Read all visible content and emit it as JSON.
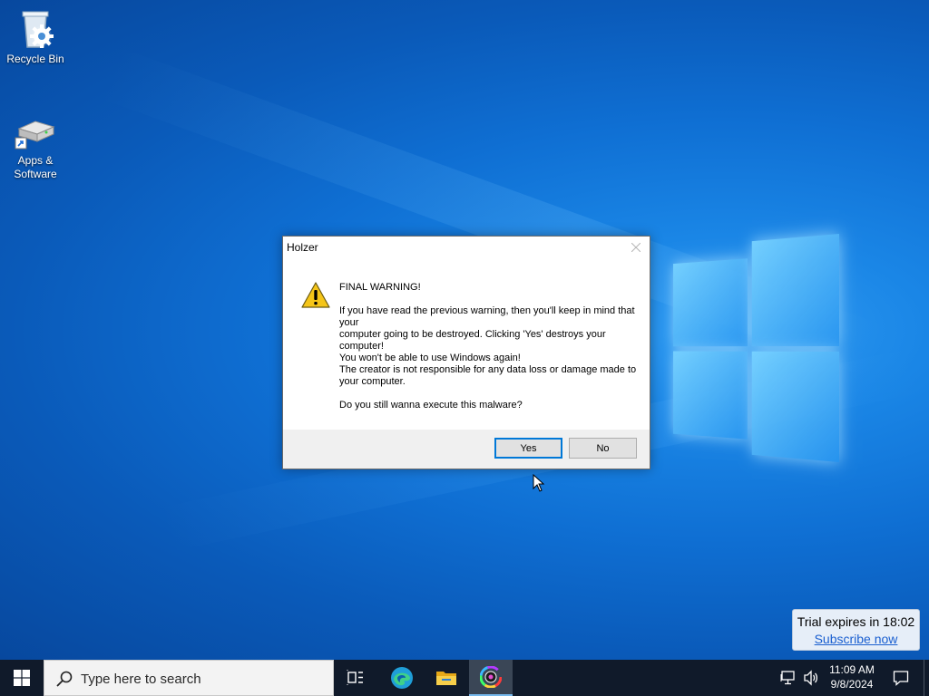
{
  "desktop": {
    "icons": [
      {
        "label": "Recycle Bin",
        "icon": "recycle-bin-icon"
      },
      {
        "label": "Apps & Software",
        "icon": "apps-drive-icon"
      }
    ]
  },
  "dialog": {
    "title": "Holzer",
    "icon": "warning-icon",
    "message": {
      "heading": "FINAL WARNING!",
      "line1": "If you have read the previous warning, then you'll keep in mind that your",
      "line2": "computer going to be destroyed. Clicking 'Yes' destroys your computer!",
      "line3": "You won't be able to use Windows again!",
      "line4": "The creator is not responsible for any data loss or damage made to your computer.",
      "question": "Do you still wanna execute this malware?"
    },
    "buttons": {
      "yes": "Yes",
      "no": "No"
    }
  },
  "trial": {
    "text": "Trial expires in 18:02",
    "link": "Subscribe now"
  },
  "taskbar": {
    "search_placeholder": "Type here to search",
    "apps": [
      "task-view-icon",
      "edge-icon",
      "file-explorer-icon",
      "color-wheel-app-icon"
    ],
    "clock": {
      "time": "11:09 AM",
      "date": "9/8/2024"
    }
  },
  "colors": {
    "accent": "#0078d7",
    "taskbar": "#101a2a",
    "desktop": "#0f6fd3"
  }
}
